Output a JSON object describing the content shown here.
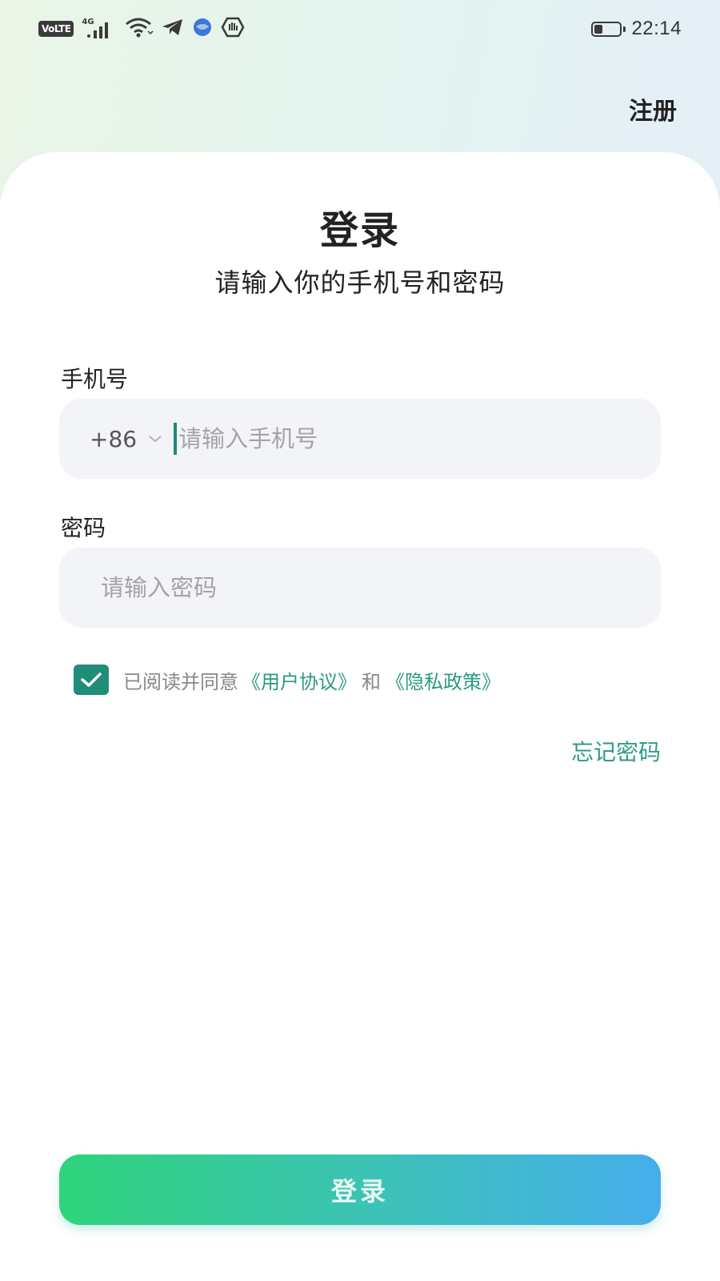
{
  "status_bar": {
    "volte": "VoLTE",
    "network": "4G",
    "time": "22:14",
    "battery_level": 0.35
  },
  "header": {
    "register_label": "注册"
  },
  "login": {
    "title": "登录",
    "subtitle": "请输入你的手机号和密码"
  },
  "phone": {
    "label": "手机号",
    "country_code": "+86",
    "placeholder": "请输入手机号",
    "value": ""
  },
  "password": {
    "label": "密码",
    "placeholder": "请输入密码",
    "value": ""
  },
  "agreement": {
    "checked": true,
    "prefix": "已阅读并同意",
    "user_agreement": "《用户协议》",
    "and": "和",
    "privacy_policy": "《隐私政策》"
  },
  "forgot_password_label": "忘记密码",
  "login_button_label": "登录",
  "colors": {
    "accent": "#1f8d78",
    "link": "#2a9a83",
    "button_gradient_start": "#2fd47b",
    "button_gradient_end": "#46aeec"
  }
}
